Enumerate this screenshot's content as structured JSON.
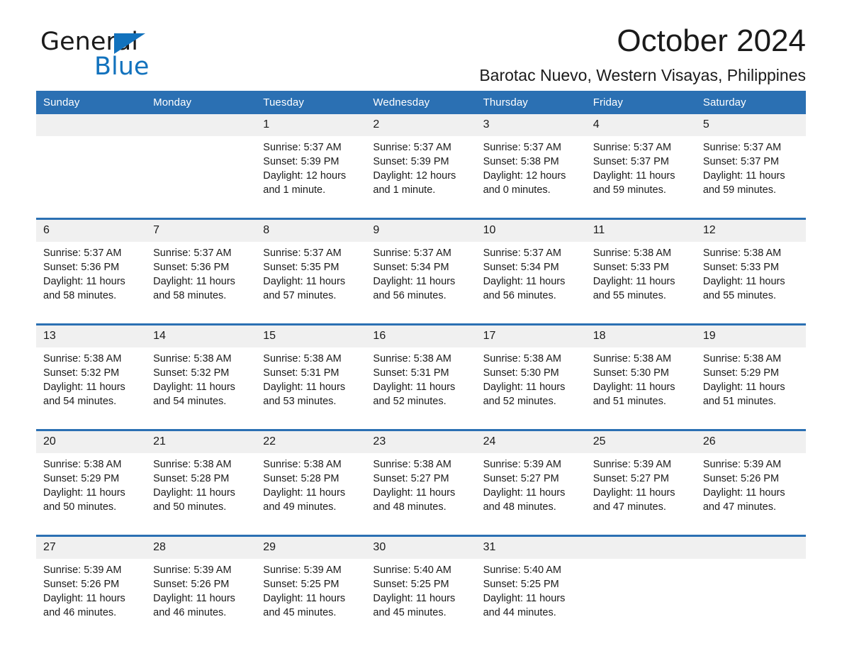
{
  "brand": {
    "name_part1": "General",
    "name_part2": "Blue",
    "triangle_color": "#1272bd"
  },
  "header": {
    "title": "October 2024",
    "subtitle": "Barotac Nuevo, Western Visayas, Philippines"
  },
  "theme": {
    "header_blue": "#2b70b3",
    "date_band": "#f0f0f0",
    "text": "#1a1a1a"
  },
  "weekday_headers": [
    "Sunday",
    "Monday",
    "Tuesday",
    "Wednesday",
    "Thursday",
    "Friday",
    "Saturday"
  ],
  "weeks": [
    [
      {
        "day": "",
        "lines": [
          "",
          "",
          "",
          ""
        ]
      },
      {
        "day": "",
        "lines": [
          "",
          "",
          "",
          ""
        ]
      },
      {
        "day": "1",
        "lines": [
          "Sunrise: 5:37 AM",
          "Sunset: 5:39 PM",
          "Daylight: 12 hours",
          "and 1 minute."
        ]
      },
      {
        "day": "2",
        "lines": [
          "Sunrise: 5:37 AM",
          "Sunset: 5:39 PM",
          "Daylight: 12 hours",
          "and 1 minute."
        ]
      },
      {
        "day": "3",
        "lines": [
          "Sunrise: 5:37 AM",
          "Sunset: 5:38 PM",
          "Daylight: 12 hours",
          "and 0 minutes."
        ]
      },
      {
        "day": "4",
        "lines": [
          "Sunrise: 5:37 AM",
          "Sunset: 5:37 PM",
          "Daylight: 11 hours",
          "and 59 minutes."
        ]
      },
      {
        "day": "5",
        "lines": [
          "Sunrise: 5:37 AM",
          "Sunset: 5:37 PM",
          "Daylight: 11 hours",
          "and 59 minutes."
        ]
      }
    ],
    [
      {
        "day": "6",
        "lines": [
          "Sunrise: 5:37 AM",
          "Sunset: 5:36 PM",
          "Daylight: 11 hours",
          "and 58 minutes."
        ]
      },
      {
        "day": "7",
        "lines": [
          "Sunrise: 5:37 AM",
          "Sunset: 5:36 PM",
          "Daylight: 11 hours",
          "and 58 minutes."
        ]
      },
      {
        "day": "8",
        "lines": [
          "Sunrise: 5:37 AM",
          "Sunset: 5:35 PM",
          "Daylight: 11 hours",
          "and 57 minutes."
        ]
      },
      {
        "day": "9",
        "lines": [
          "Sunrise: 5:37 AM",
          "Sunset: 5:34 PM",
          "Daylight: 11 hours",
          "and 56 minutes."
        ]
      },
      {
        "day": "10",
        "lines": [
          "Sunrise: 5:37 AM",
          "Sunset: 5:34 PM",
          "Daylight: 11 hours",
          "and 56 minutes."
        ]
      },
      {
        "day": "11",
        "lines": [
          "Sunrise: 5:38 AM",
          "Sunset: 5:33 PM",
          "Daylight: 11 hours",
          "and 55 minutes."
        ]
      },
      {
        "day": "12",
        "lines": [
          "Sunrise: 5:38 AM",
          "Sunset: 5:33 PM",
          "Daylight: 11 hours",
          "and 55 minutes."
        ]
      }
    ],
    [
      {
        "day": "13",
        "lines": [
          "Sunrise: 5:38 AM",
          "Sunset: 5:32 PM",
          "Daylight: 11 hours",
          "and 54 minutes."
        ]
      },
      {
        "day": "14",
        "lines": [
          "Sunrise: 5:38 AM",
          "Sunset: 5:32 PM",
          "Daylight: 11 hours",
          "and 54 minutes."
        ]
      },
      {
        "day": "15",
        "lines": [
          "Sunrise: 5:38 AM",
          "Sunset: 5:31 PM",
          "Daylight: 11 hours",
          "and 53 minutes."
        ]
      },
      {
        "day": "16",
        "lines": [
          "Sunrise: 5:38 AM",
          "Sunset: 5:31 PM",
          "Daylight: 11 hours",
          "and 52 minutes."
        ]
      },
      {
        "day": "17",
        "lines": [
          "Sunrise: 5:38 AM",
          "Sunset: 5:30 PM",
          "Daylight: 11 hours",
          "and 52 minutes."
        ]
      },
      {
        "day": "18",
        "lines": [
          "Sunrise: 5:38 AM",
          "Sunset: 5:30 PM",
          "Daylight: 11 hours",
          "and 51 minutes."
        ]
      },
      {
        "day": "19",
        "lines": [
          "Sunrise: 5:38 AM",
          "Sunset: 5:29 PM",
          "Daylight: 11 hours",
          "and 51 minutes."
        ]
      }
    ],
    [
      {
        "day": "20",
        "lines": [
          "Sunrise: 5:38 AM",
          "Sunset: 5:29 PM",
          "Daylight: 11 hours",
          "and 50 minutes."
        ]
      },
      {
        "day": "21",
        "lines": [
          "Sunrise: 5:38 AM",
          "Sunset: 5:28 PM",
          "Daylight: 11 hours",
          "and 50 minutes."
        ]
      },
      {
        "day": "22",
        "lines": [
          "Sunrise: 5:38 AM",
          "Sunset: 5:28 PM",
          "Daylight: 11 hours",
          "and 49 minutes."
        ]
      },
      {
        "day": "23",
        "lines": [
          "Sunrise: 5:38 AM",
          "Sunset: 5:27 PM",
          "Daylight: 11 hours",
          "and 48 minutes."
        ]
      },
      {
        "day": "24",
        "lines": [
          "Sunrise: 5:39 AM",
          "Sunset: 5:27 PM",
          "Daylight: 11 hours",
          "and 48 minutes."
        ]
      },
      {
        "day": "25",
        "lines": [
          "Sunrise: 5:39 AM",
          "Sunset: 5:27 PM",
          "Daylight: 11 hours",
          "and 47 minutes."
        ]
      },
      {
        "day": "26",
        "lines": [
          "Sunrise: 5:39 AM",
          "Sunset: 5:26 PM",
          "Daylight: 11 hours",
          "and 47 minutes."
        ]
      }
    ],
    [
      {
        "day": "27",
        "lines": [
          "Sunrise: 5:39 AM",
          "Sunset: 5:26 PM",
          "Daylight: 11 hours",
          "and 46 minutes."
        ]
      },
      {
        "day": "28",
        "lines": [
          "Sunrise: 5:39 AM",
          "Sunset: 5:26 PM",
          "Daylight: 11 hours",
          "and 46 minutes."
        ]
      },
      {
        "day": "29",
        "lines": [
          "Sunrise: 5:39 AM",
          "Sunset: 5:25 PM",
          "Daylight: 11 hours",
          "and 45 minutes."
        ]
      },
      {
        "day": "30",
        "lines": [
          "Sunrise: 5:40 AM",
          "Sunset: 5:25 PM",
          "Daylight: 11 hours",
          "and 45 minutes."
        ]
      },
      {
        "day": "31",
        "lines": [
          "Sunrise: 5:40 AM",
          "Sunset: 5:25 PM",
          "Daylight: 11 hours",
          "and 44 minutes."
        ]
      },
      {
        "day": "",
        "lines": [
          "",
          "",
          "",
          ""
        ]
      },
      {
        "day": "",
        "lines": [
          "",
          "",
          "",
          ""
        ]
      }
    ]
  ]
}
